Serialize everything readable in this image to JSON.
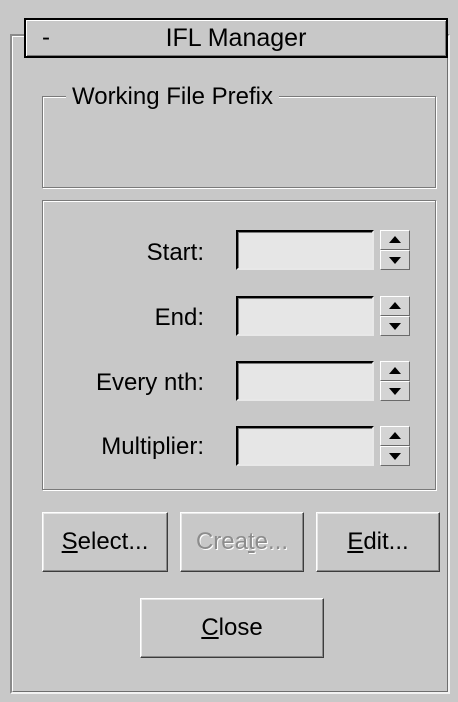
{
  "rollout": {
    "collapse_symbol": "-",
    "title": "IFL Manager"
  },
  "prefix_group": {
    "label": "Working File Prefix",
    "value": ""
  },
  "fields": {
    "start": {
      "label": "Start:",
      "value": ""
    },
    "end": {
      "label": "End:",
      "value": ""
    },
    "every_nth": {
      "label": "Every nth:",
      "value": ""
    },
    "multiplier": {
      "label": "Multiplier:",
      "value": ""
    }
  },
  "buttons": {
    "select": {
      "mnemonic": "S",
      "rest": "elect...",
      "enabled": true
    },
    "create": {
      "before": "Crea",
      "mnemonic": "t",
      "rest": "e...",
      "enabled": false
    },
    "edit": {
      "mnemonic": "E",
      "rest": "dit...",
      "enabled": true
    },
    "close": {
      "mnemonic": "C",
      "rest": "lose",
      "enabled": true
    }
  }
}
